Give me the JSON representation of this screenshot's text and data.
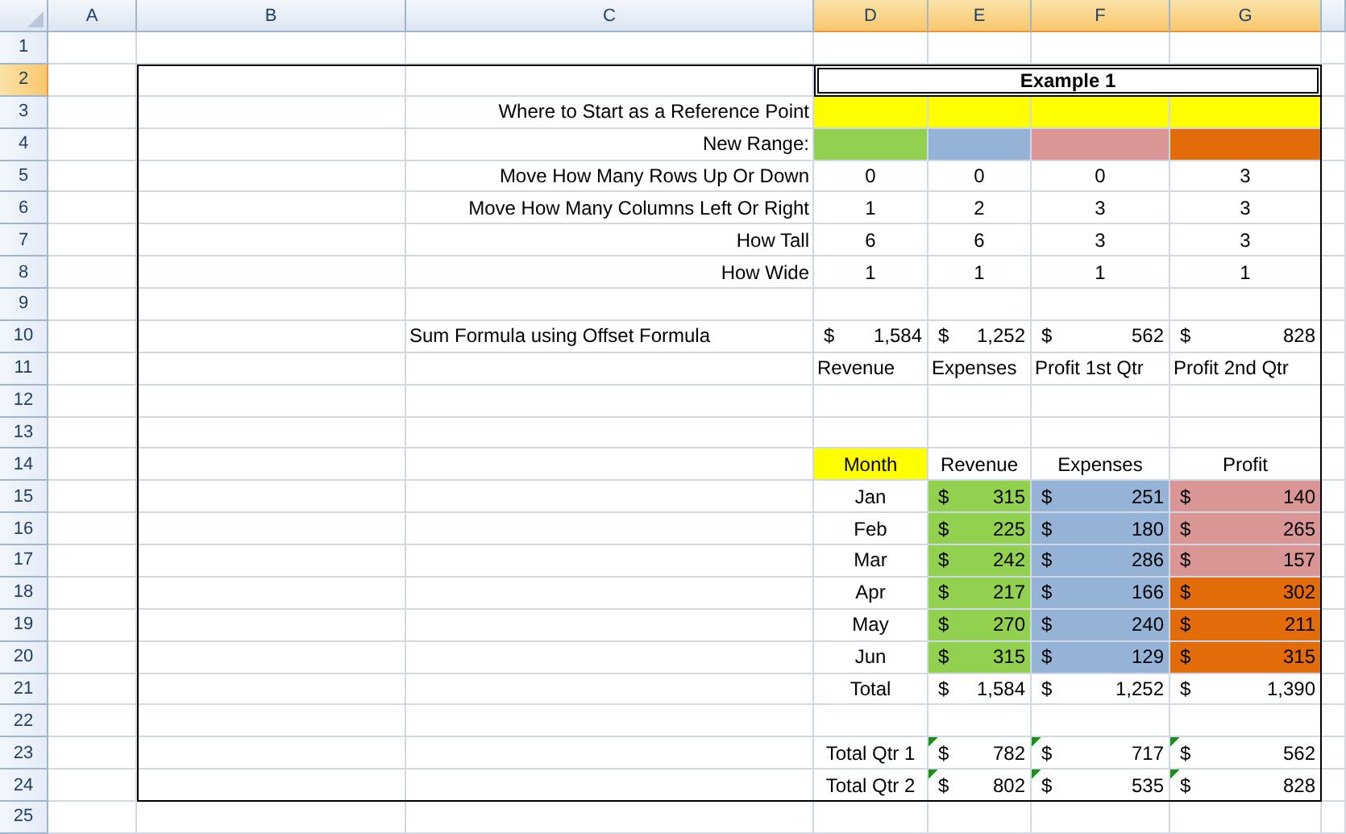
{
  "columns": [
    {
      "label": "A",
      "selected": false
    },
    {
      "label": "B",
      "selected": false
    },
    {
      "label": "C",
      "selected": false
    },
    {
      "label": "D",
      "selected": true
    },
    {
      "label": "E",
      "selected": true
    },
    {
      "label": "F",
      "selected": true
    },
    {
      "label": "G",
      "selected": true
    }
  ],
  "rows": [
    {
      "label": "1",
      "selected": false,
      "cells": []
    },
    {
      "label": "2",
      "selected": true,
      "cells": [
        {
          "kind": "empty"
        },
        {
          "kind": "empty"
        },
        {
          "kind": "empty"
        },
        {
          "kind": "title",
          "text": "Example 1"
        }
      ]
    },
    {
      "label": "3",
      "selected": false,
      "cells": [
        {
          "kind": "empty"
        },
        {
          "kind": "empty"
        },
        {
          "kind": "label",
          "text": "Where to Start as a Reference Point"
        },
        {
          "kind": "fill",
          "color": "#ffff00"
        },
        {
          "kind": "fill",
          "color": "#ffff00"
        },
        {
          "kind": "fill",
          "color": "#ffff00"
        },
        {
          "kind": "fill",
          "color": "#ffff00"
        }
      ]
    },
    {
      "label": "4",
      "selected": false,
      "cells": [
        {
          "kind": "empty"
        },
        {
          "kind": "empty"
        },
        {
          "kind": "label",
          "text": "New Range:"
        },
        {
          "kind": "fill",
          "color": "#92d050"
        },
        {
          "kind": "fill",
          "color": "#95b3d7"
        },
        {
          "kind": "fill",
          "color": "#da9694"
        },
        {
          "kind": "fill",
          "color": "#e26b0a"
        }
      ]
    },
    {
      "label": "5",
      "selected": false,
      "cells": [
        {
          "kind": "empty"
        },
        {
          "kind": "empty"
        },
        {
          "kind": "label",
          "text": "Move How Many Rows Up Or Down"
        },
        {
          "kind": "center",
          "text": "0"
        },
        {
          "kind": "center",
          "text": "0"
        },
        {
          "kind": "center",
          "text": "0"
        },
        {
          "kind": "center",
          "text": "3"
        }
      ]
    },
    {
      "label": "6",
      "selected": false,
      "cells": [
        {
          "kind": "empty"
        },
        {
          "kind": "empty"
        },
        {
          "kind": "label",
          "text": "Move How Many Columns Left Or Right"
        },
        {
          "kind": "center",
          "text": "1"
        },
        {
          "kind": "center",
          "text": "2"
        },
        {
          "kind": "center",
          "text": "3"
        },
        {
          "kind": "center",
          "text": "3"
        }
      ]
    },
    {
      "label": "7",
      "selected": false,
      "cells": [
        {
          "kind": "empty"
        },
        {
          "kind": "empty"
        },
        {
          "kind": "label",
          "text": "How Tall"
        },
        {
          "kind": "center",
          "text": "6"
        },
        {
          "kind": "center",
          "text": "6"
        },
        {
          "kind": "center",
          "text": "3"
        },
        {
          "kind": "center",
          "text": "3"
        }
      ]
    },
    {
      "label": "8",
      "selected": false,
      "cells": [
        {
          "kind": "empty"
        },
        {
          "kind": "empty"
        },
        {
          "kind": "label",
          "text": "How Wide"
        },
        {
          "kind": "center",
          "text": "1"
        },
        {
          "kind": "center",
          "text": "1"
        },
        {
          "kind": "center",
          "text": "1"
        },
        {
          "kind": "center",
          "text": "1"
        }
      ]
    },
    {
      "label": "9",
      "selected": false,
      "cells": []
    },
    {
      "label": "10",
      "selected": false,
      "cells": [
        {
          "kind": "empty"
        },
        {
          "kind": "empty"
        },
        {
          "kind": "note",
          "text": "Sum Formula using Offset Formula"
        },
        {
          "kind": "currency",
          "symbol": "$",
          "text": "1,584"
        },
        {
          "kind": "currency",
          "symbol": "$",
          "text": "1,252"
        },
        {
          "kind": "currency",
          "symbol": "$",
          "text": "562"
        },
        {
          "kind": "currency",
          "symbol": "$",
          "text": "828"
        }
      ]
    },
    {
      "label": "11",
      "selected": false,
      "cells": [
        {
          "kind": "empty"
        },
        {
          "kind": "empty"
        },
        {
          "kind": "empty"
        },
        {
          "kind": "note",
          "text": "Revenue"
        },
        {
          "kind": "note",
          "text": "Expenses"
        },
        {
          "kind": "note",
          "text": "Profit 1st Qtr"
        },
        {
          "kind": "note",
          "text": "Profit 2nd Qtr"
        }
      ]
    },
    {
      "label": "12",
      "selected": false,
      "cells": []
    },
    {
      "label": "13",
      "selected": false,
      "cells": []
    },
    {
      "label": "14",
      "selected": false,
      "cells": [
        {
          "kind": "empty"
        },
        {
          "kind": "empty"
        },
        {
          "kind": "empty"
        },
        {
          "kind": "center",
          "text": "Month",
          "color": "#ffff00"
        },
        {
          "kind": "center",
          "text": "Revenue"
        },
        {
          "kind": "center",
          "text": "Expenses"
        },
        {
          "kind": "center",
          "text": "Profit"
        }
      ]
    },
    {
      "label": "15",
      "selected": false,
      "cells": [
        {
          "kind": "empty"
        },
        {
          "kind": "empty"
        },
        {
          "kind": "empty"
        },
        {
          "kind": "center",
          "text": "Jan"
        },
        {
          "kind": "currency",
          "symbol": "$",
          "text": "315",
          "color": "#92d050"
        },
        {
          "kind": "currency",
          "symbol": "$",
          "text": "251",
          "color": "#95b3d7"
        },
        {
          "kind": "currency",
          "symbol": "$",
          "text": "140",
          "color": "#da9694"
        }
      ]
    },
    {
      "label": "16",
      "selected": false,
      "cells": [
        {
          "kind": "empty"
        },
        {
          "kind": "empty"
        },
        {
          "kind": "empty"
        },
        {
          "kind": "center",
          "text": "Feb"
        },
        {
          "kind": "currency",
          "symbol": "$",
          "text": "225",
          "color": "#92d050"
        },
        {
          "kind": "currency",
          "symbol": "$",
          "text": "180",
          "color": "#95b3d7"
        },
        {
          "kind": "currency",
          "symbol": "$",
          "text": "265",
          "color": "#da9694"
        }
      ]
    },
    {
      "label": "17",
      "selected": false,
      "cells": [
        {
          "kind": "empty"
        },
        {
          "kind": "empty"
        },
        {
          "kind": "empty"
        },
        {
          "kind": "center",
          "text": "Mar"
        },
        {
          "kind": "currency",
          "symbol": "$",
          "text": "242",
          "color": "#92d050"
        },
        {
          "kind": "currency",
          "symbol": "$",
          "text": "286",
          "color": "#95b3d7"
        },
        {
          "kind": "currency",
          "symbol": "$",
          "text": "157",
          "color": "#da9694"
        }
      ]
    },
    {
      "label": "18",
      "selected": false,
      "cells": [
        {
          "kind": "empty"
        },
        {
          "kind": "empty"
        },
        {
          "kind": "empty"
        },
        {
          "kind": "center",
          "text": "Apr"
        },
        {
          "kind": "currency",
          "symbol": "$",
          "text": "217",
          "color": "#92d050"
        },
        {
          "kind": "currency",
          "symbol": "$",
          "text": "166",
          "color": "#95b3d7"
        },
        {
          "kind": "currency",
          "symbol": "$",
          "text": "302",
          "color": "#e26b0a"
        }
      ]
    },
    {
      "label": "19",
      "selected": false,
      "cells": [
        {
          "kind": "empty"
        },
        {
          "kind": "empty"
        },
        {
          "kind": "empty"
        },
        {
          "kind": "center",
          "text": "May"
        },
        {
          "kind": "currency",
          "symbol": "$",
          "text": "270",
          "color": "#92d050"
        },
        {
          "kind": "currency",
          "symbol": "$",
          "text": "240",
          "color": "#95b3d7"
        },
        {
          "kind": "currency",
          "symbol": "$",
          "text": "211",
          "color": "#e26b0a"
        }
      ]
    },
    {
      "label": "20",
      "selected": false,
      "cells": [
        {
          "kind": "empty"
        },
        {
          "kind": "empty"
        },
        {
          "kind": "empty"
        },
        {
          "kind": "center",
          "text": "Jun"
        },
        {
          "kind": "currency",
          "symbol": "$",
          "text": "315",
          "color": "#92d050"
        },
        {
          "kind": "currency",
          "symbol": "$",
          "text": "129",
          "color": "#95b3d7"
        },
        {
          "kind": "currency",
          "symbol": "$",
          "text": "315",
          "color": "#e26b0a"
        }
      ]
    },
    {
      "label": "21",
      "selected": false,
      "cells": [
        {
          "kind": "empty"
        },
        {
          "kind": "empty"
        },
        {
          "kind": "empty"
        },
        {
          "kind": "center",
          "text": "Total"
        },
        {
          "kind": "currency",
          "symbol": "$",
          "text": "1,584"
        },
        {
          "kind": "currency",
          "symbol": "$",
          "text": "1,252"
        },
        {
          "kind": "currency",
          "symbol": "$",
          "text": "1,390"
        }
      ]
    },
    {
      "label": "22",
      "selected": false,
      "cells": []
    },
    {
      "label": "23",
      "selected": false,
      "cells": [
        {
          "kind": "empty"
        },
        {
          "kind": "empty"
        },
        {
          "kind": "empty"
        },
        {
          "kind": "center",
          "text": "Total Qtr 1"
        },
        {
          "kind": "currency",
          "symbol": "$",
          "text": "782",
          "flagged": true
        },
        {
          "kind": "currency",
          "symbol": "$",
          "text": "717",
          "flagged": true
        },
        {
          "kind": "currency",
          "symbol": "$",
          "text": "562",
          "flagged": true
        }
      ]
    },
    {
      "label": "24",
      "selected": false,
      "cells": [
        {
          "kind": "empty"
        },
        {
          "kind": "empty"
        },
        {
          "kind": "empty"
        },
        {
          "kind": "center",
          "text": "Total Qtr 2"
        },
        {
          "kind": "currency",
          "symbol": "$",
          "text": "802",
          "flagged": true
        },
        {
          "kind": "currency",
          "symbol": "$",
          "text": "535",
          "flagged": true
        },
        {
          "kind": "currency",
          "symbol": "$",
          "text": "828",
          "flagged": true
        }
      ]
    },
    {
      "label": "25",
      "selected": false,
      "cells": []
    }
  ]
}
